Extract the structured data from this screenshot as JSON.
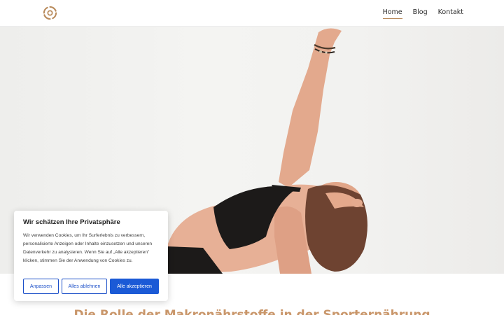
{
  "header": {
    "logo_icon": "sun-burst-logo-icon",
    "nav": [
      {
        "label": "Home",
        "active": true
      },
      {
        "label": "Blog",
        "active": false
      },
      {
        "label": "Kontakt",
        "active": false
      }
    ]
  },
  "article": {
    "title": "Die Rolle der Makronährstoffe in der Sporternährung"
  },
  "cookie_banner": {
    "title": "Wir schätzen Ihre Privatsphäre",
    "text": "Wir verwenden Cookies, um Ihr Surferlebnis zu verbessern, personalisierte Anzeigen oder Inhalte einzusetzen und unseren Datenverkehr zu analysieren. Wenn Sie auf „Alle akzeptieren\" klicken, stimmen Sie der Anwendung von Cookies zu.",
    "buttons": {
      "customize": "Anpassen",
      "reject": "Alles ablehnen",
      "accept": "Alle akzeptieren"
    }
  },
  "colors": {
    "accent": "#b98b5c",
    "title": "#c9966a",
    "primary_button": "#1b5ad6"
  }
}
